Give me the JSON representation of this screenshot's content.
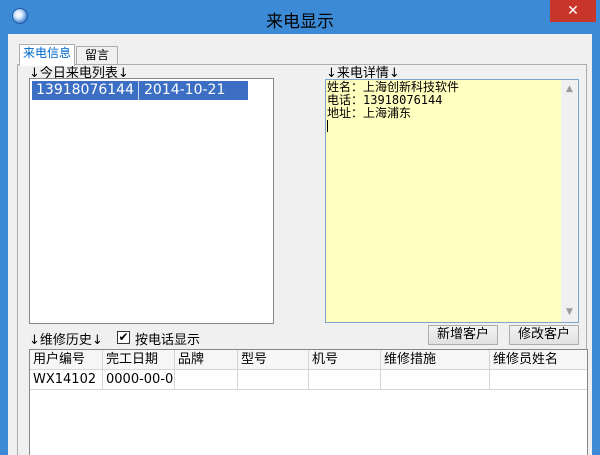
{
  "window": {
    "title": "来电显示",
    "close_glyph": "✕"
  },
  "tabs": [
    {
      "label": "来电信息",
      "active": true
    },
    {
      "label": "留言",
      "active": false
    }
  ],
  "call_list": {
    "label": "↓今日来电列表↓",
    "rows": [
      {
        "phone": "13918076144",
        "date": "2014-10-21",
        "selected": true
      }
    ]
  },
  "call_detail": {
    "label": "↓来电详情↓",
    "lines": [
      "姓名：上海创新科技软件",
      "电话：13918076144",
      "地址：上海浦东"
    ],
    "background": "#ffffc0"
  },
  "buttons": {
    "add_customer": "新增客户",
    "edit_customer": "修改客户"
  },
  "history": {
    "label": "↓维修历史↓",
    "by_phone_label": "按电话显示",
    "by_phone_checked": true,
    "check_glyph": "✔",
    "columns": [
      "用户编号",
      "完工日期",
      "品牌",
      "型号",
      "机号",
      "维修措施",
      "维修员姓名"
    ],
    "rows": [
      [
        "WX14102",
        "0000-00-0",
        "",
        "",
        "",
        "",
        ""
      ]
    ]
  },
  "scrollbar": {
    "up_glyph": "▲",
    "down_glyph": "▼"
  },
  "colors": {
    "titlebar": "#3c8ad6",
    "close": "#c7352b",
    "selection": "#3c6fc4",
    "active_tab_text": "#0066cc"
  }
}
